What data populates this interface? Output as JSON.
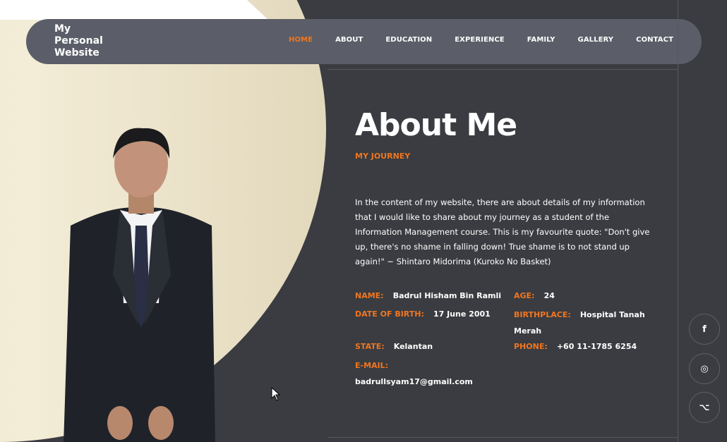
{
  "brand": {
    "line1": "My",
    "line2": "Personal",
    "line3": "Website"
  },
  "nav": [
    {
      "label": "HOME",
      "active": true
    },
    {
      "label": "ABOUT",
      "active": false
    },
    {
      "label": "EDUCATION",
      "active": false
    },
    {
      "label": "EXPERIENCE",
      "active": false
    },
    {
      "label": "FAMILY",
      "active": false
    },
    {
      "label": "GALLERY",
      "active": false
    },
    {
      "label": "CONTACT",
      "active": false
    }
  ],
  "about": {
    "title": "About Me",
    "subtitle": "MY JOURNEY",
    "intro": "In the content of my website, there are about details of my information that I would like to share about my journey as a student of the Information Management course. This is my favourite quote: \"Don't give up, there's no shame in falling down! True shame is to not stand up again!\" ~ Shintaro Midorima (Kuroko No Basket)"
  },
  "info": {
    "name": {
      "label": "NAME:",
      "value": "Badrul Hisham Bin Ramli"
    },
    "age": {
      "label": "AGE:",
      "value": "24"
    },
    "dob": {
      "label": "DATE OF BIRTH:",
      "value": "17 June 2001"
    },
    "birthplace": {
      "label": "BIRTHPLACE:",
      "value_line1": "Hospital Tanah",
      "value_line2": "Merah"
    },
    "state": {
      "label": "STATE:",
      "value": "Kelantan"
    },
    "phone": {
      "label": "PHONE:",
      "value": "+60 11-1785 6254"
    },
    "email": {
      "label": "E-MAIL:",
      "value": "badrullsyam17@gmail.com"
    }
  },
  "social": [
    {
      "icon": "facebook-icon",
      "glyph": "f"
    },
    {
      "icon": "instagram-icon",
      "glyph": "◎"
    },
    {
      "icon": "github-icon",
      "glyph": "⌥"
    }
  ],
  "colors": {
    "accent": "#f0761f",
    "background": "#3a3c41",
    "navbar": "#5b5e68"
  }
}
